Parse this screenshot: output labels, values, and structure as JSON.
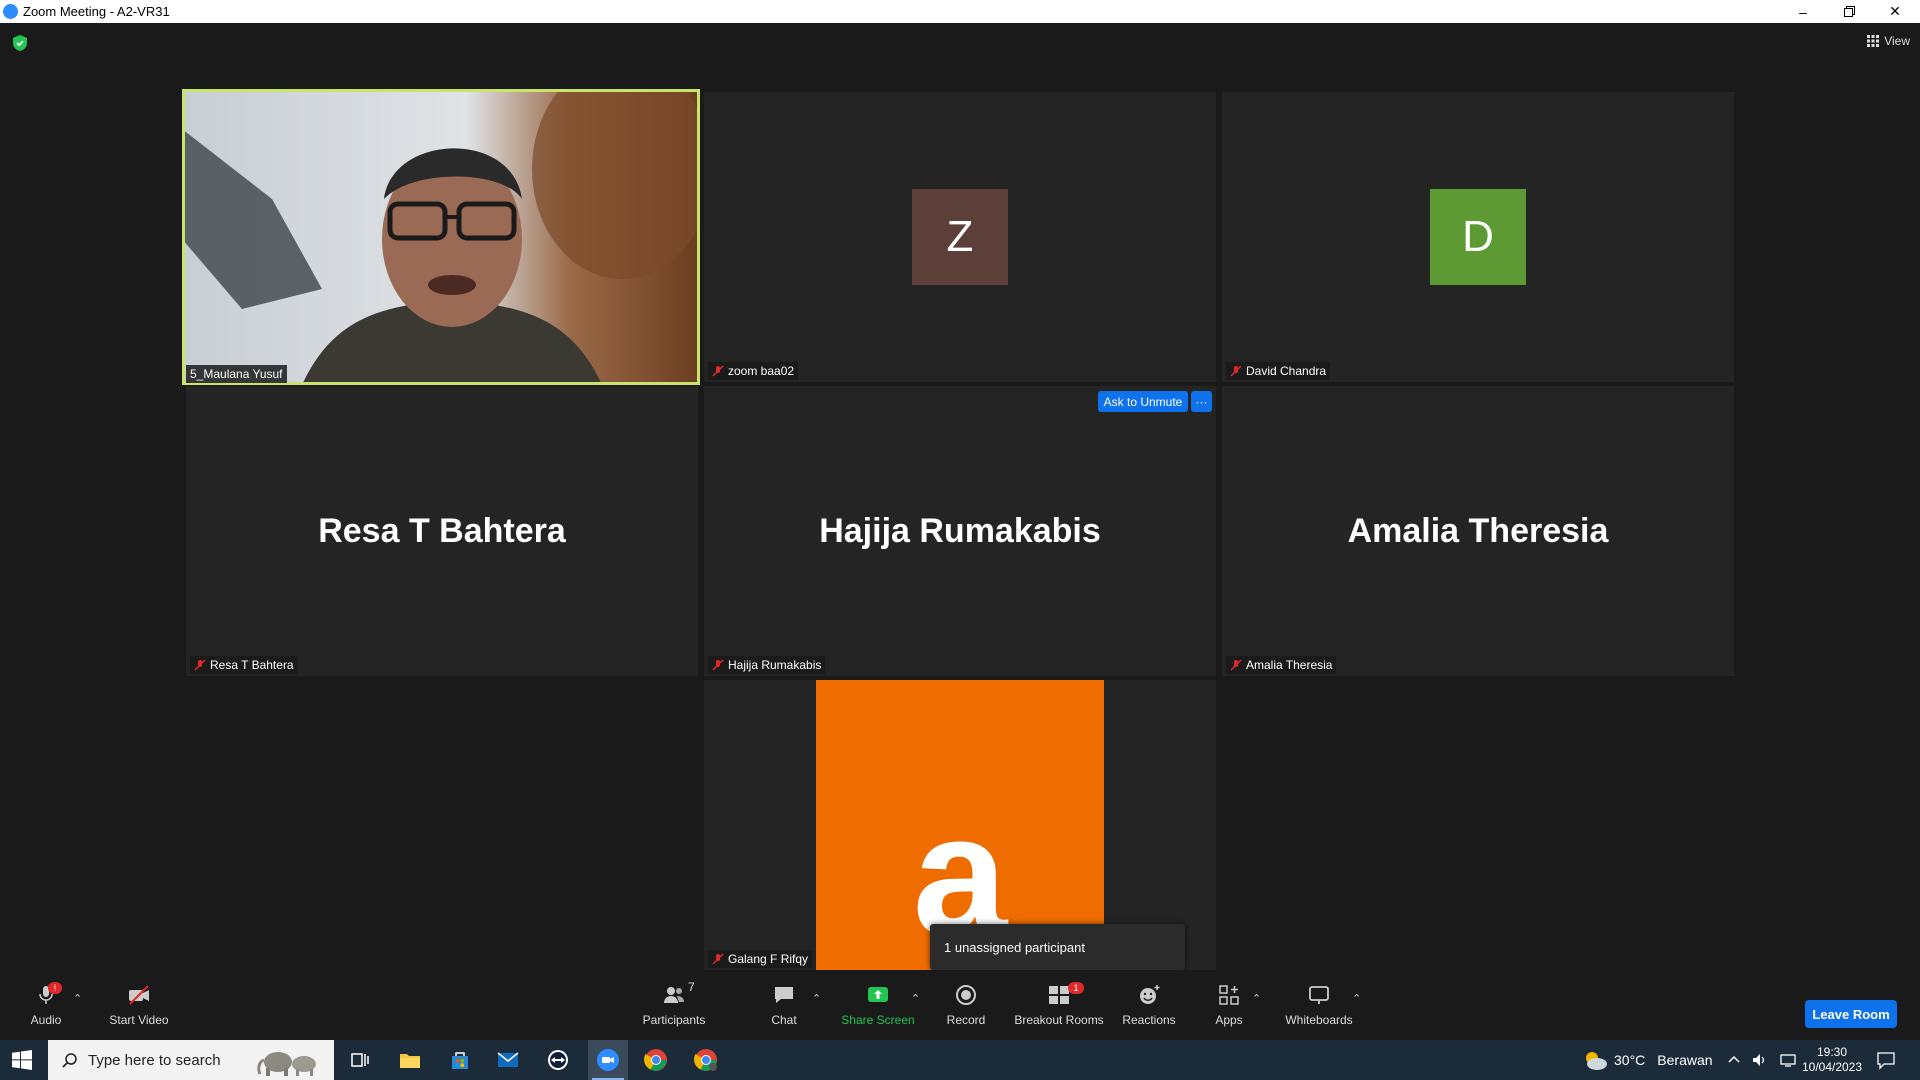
{
  "window": {
    "title": "Zoom Meeting - A2-VR31"
  },
  "top": {
    "view_label": "View"
  },
  "tiles": [
    {
      "name": "5_Maulana Yusuf",
      "type": "video",
      "muted": false,
      "active": true
    },
    {
      "name": "zoom baa02",
      "type": "avatar",
      "initial": "Z",
      "avatar_color": "#5b3f38",
      "muted": true
    },
    {
      "name": "David Chandra",
      "type": "avatar",
      "initial": "D",
      "avatar_color": "#5e9a33",
      "muted": true
    },
    {
      "name": "Resa T Bahtera",
      "type": "name",
      "center_name": "Resa T Bahtera",
      "muted": true
    },
    {
      "name": "Hajija Rumakabis",
      "type": "name",
      "center_name": "Hajija Rumakabis",
      "muted": true,
      "hover_button": "Ask to Unmute",
      "more_button": "···"
    },
    {
      "name": "Amalia Theresia",
      "type": "name",
      "center_name": "Amalia Theresia",
      "muted": true
    },
    {
      "name": "Galang F Rifqy",
      "type": "avatar-image",
      "initial": "a",
      "avatar_color": "#ee6c00",
      "muted": true
    }
  ],
  "tooltip": {
    "text": "1 unassigned participant"
  },
  "toolbar": {
    "audio": "Audio",
    "start_video": "Start Video",
    "participants": "Participants",
    "participants_count": "7",
    "chat": "Chat",
    "share_screen": "Share Screen",
    "record": "Record",
    "breakout_rooms": "Breakout Rooms",
    "breakout_badge": "1",
    "reactions": "Reactions",
    "apps": "Apps",
    "whiteboards": "Whiteboards",
    "leave": "Leave Room",
    "audio_badge": "!"
  },
  "taskbar": {
    "search_placeholder": "Type here to search",
    "weather_temp": "30°C",
    "weather_desc": "Berawan",
    "time": "19:30",
    "date": "10/04/2023"
  },
  "colors": {
    "accent": "#0e72ed",
    "share_green": "#23c552",
    "active_border": "#c9e46b"
  }
}
